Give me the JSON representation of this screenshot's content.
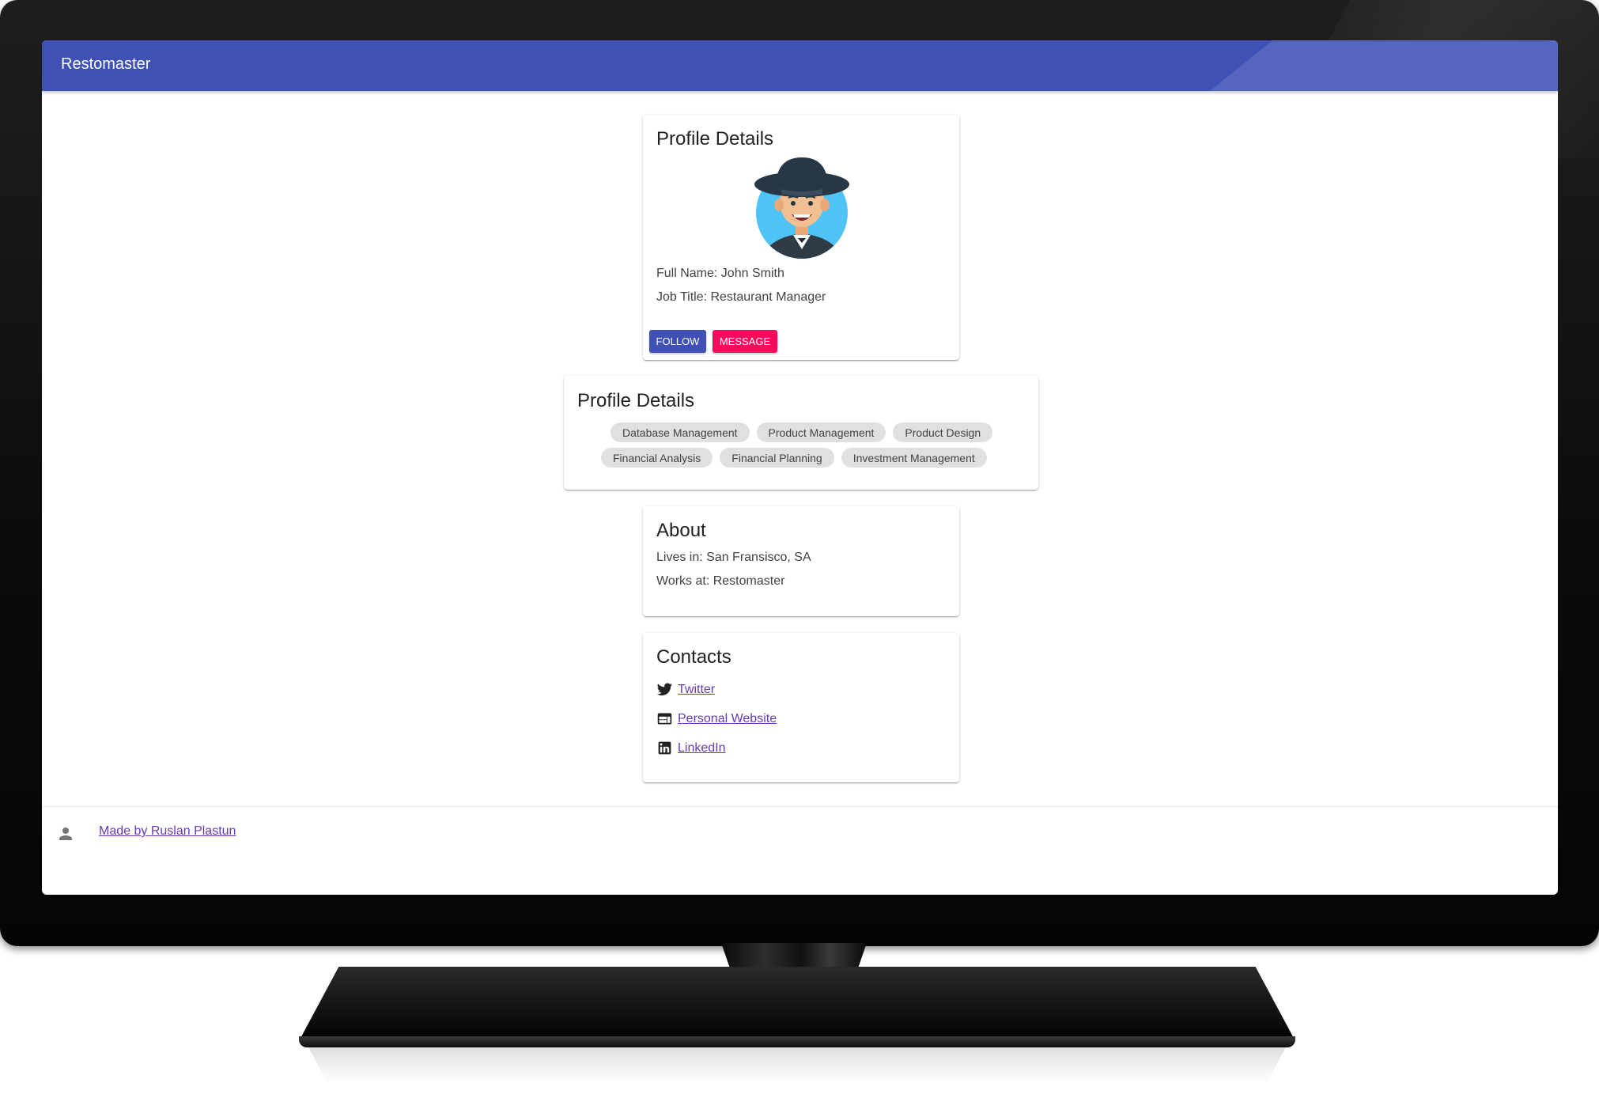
{
  "app": {
    "title": "Restomaster"
  },
  "profile": {
    "title": "Profile Details",
    "full_name": "Full Name: John Smith",
    "job_title": "Job Title: Restaurant Manager",
    "follow_label": "FOLLOW",
    "message_label": "MESSAGE"
  },
  "skills": {
    "title": "Profile Details",
    "chips": [
      "Database Management",
      "Product Management",
      "Product Design",
      "Financial Analysis",
      "Financial Planning",
      "Investment Management"
    ]
  },
  "about": {
    "title": "About",
    "lives_in": "Lives in: San Fransisco, SA",
    "works_at": "Works at: Restomaster"
  },
  "contacts": {
    "title": "Contacts",
    "links": [
      {
        "label": "Twitter",
        "icon": "twitter-icon"
      },
      {
        "label": "Personal Website",
        "icon": "website-icon"
      },
      {
        "label": "LinkedIn",
        "icon": "linkedin-icon"
      }
    ]
  },
  "footer": {
    "credit": "Made by Ruslan Plastun",
    "icon": "person-icon"
  },
  "colors": {
    "primary": "#3f51b5",
    "accent": "#ff0a5a",
    "link": "#673ab7"
  }
}
